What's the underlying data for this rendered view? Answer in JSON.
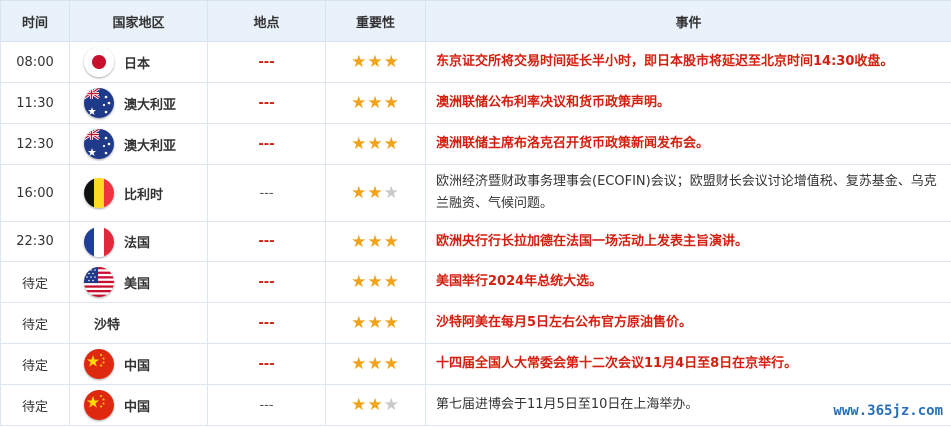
{
  "header": {
    "time": "时间",
    "country": "国家地区",
    "place": "地点",
    "importance": "重要性",
    "event": "事件"
  },
  "rows": [
    {
      "time": "08:00",
      "country": "日本",
      "flag": "japan-flag-icon",
      "place": "---",
      "stars": 3,
      "event": "东京证交所将交易时间延长半小时，即日本股市将延迟至北京时间14:30收盘。",
      "highlight": true
    },
    {
      "time": "11:30",
      "country": "澳大利亚",
      "flag": "australia-flag-icon",
      "place": "---",
      "stars": 3,
      "event": "澳洲联储公布利率决议和货币政策声明。",
      "highlight": true
    },
    {
      "time": "12:30",
      "country": "澳大利亚",
      "flag": "australia-flag-icon",
      "place": "---",
      "stars": 3,
      "event": "澳洲联储主席布洛克召开货币政策新闻发布会。",
      "highlight": true
    },
    {
      "time": "16:00",
      "country": "比利时",
      "flag": "belgium-flag-icon",
      "place": "---",
      "stars": 2,
      "event": "欧洲经济暨财政事务理事会(ECOFIN)会议；欧盟财长会议讨论增值税、复苏基金、乌克兰融资、气候问题。",
      "highlight": false
    },
    {
      "time": "22:30",
      "country": "法国",
      "flag": "france-flag-icon",
      "place": "---",
      "stars": 3,
      "event": "欧洲央行行长拉加德在法国一场活动上发表主旨演讲。",
      "highlight": true
    },
    {
      "time": "待定",
      "country": "美国",
      "flag": "usa-flag-icon",
      "place": "---",
      "stars": 3,
      "event": "美国举行2024年总统大选。",
      "highlight": true
    },
    {
      "time": "待定",
      "country": "沙特",
      "flag": "",
      "place": "---",
      "stars": 3,
      "event": "沙特阿美在每月5日左右公布官方原油售价。",
      "highlight": true
    },
    {
      "time": "待定",
      "country": "中国",
      "flag": "china-flag-icon",
      "place": "---",
      "stars": 3,
      "event": "十四届全国人大常委会第十二次会议11月4日至8日在京举行。",
      "highlight": true
    },
    {
      "time": "待定",
      "country": "中国",
      "flag": "china-flag-icon",
      "place": "---",
      "stars": 2,
      "event": "第七届进博会于11月5日至10日在上海举办。",
      "highlight": false
    }
  ],
  "watermark": "www.365jz.com",
  "colors": {
    "highlight": "#d21f0f",
    "star": "#f2a31c",
    "star_off": "#c9c9c9",
    "header_bg": "#e9f2fb"
  }
}
